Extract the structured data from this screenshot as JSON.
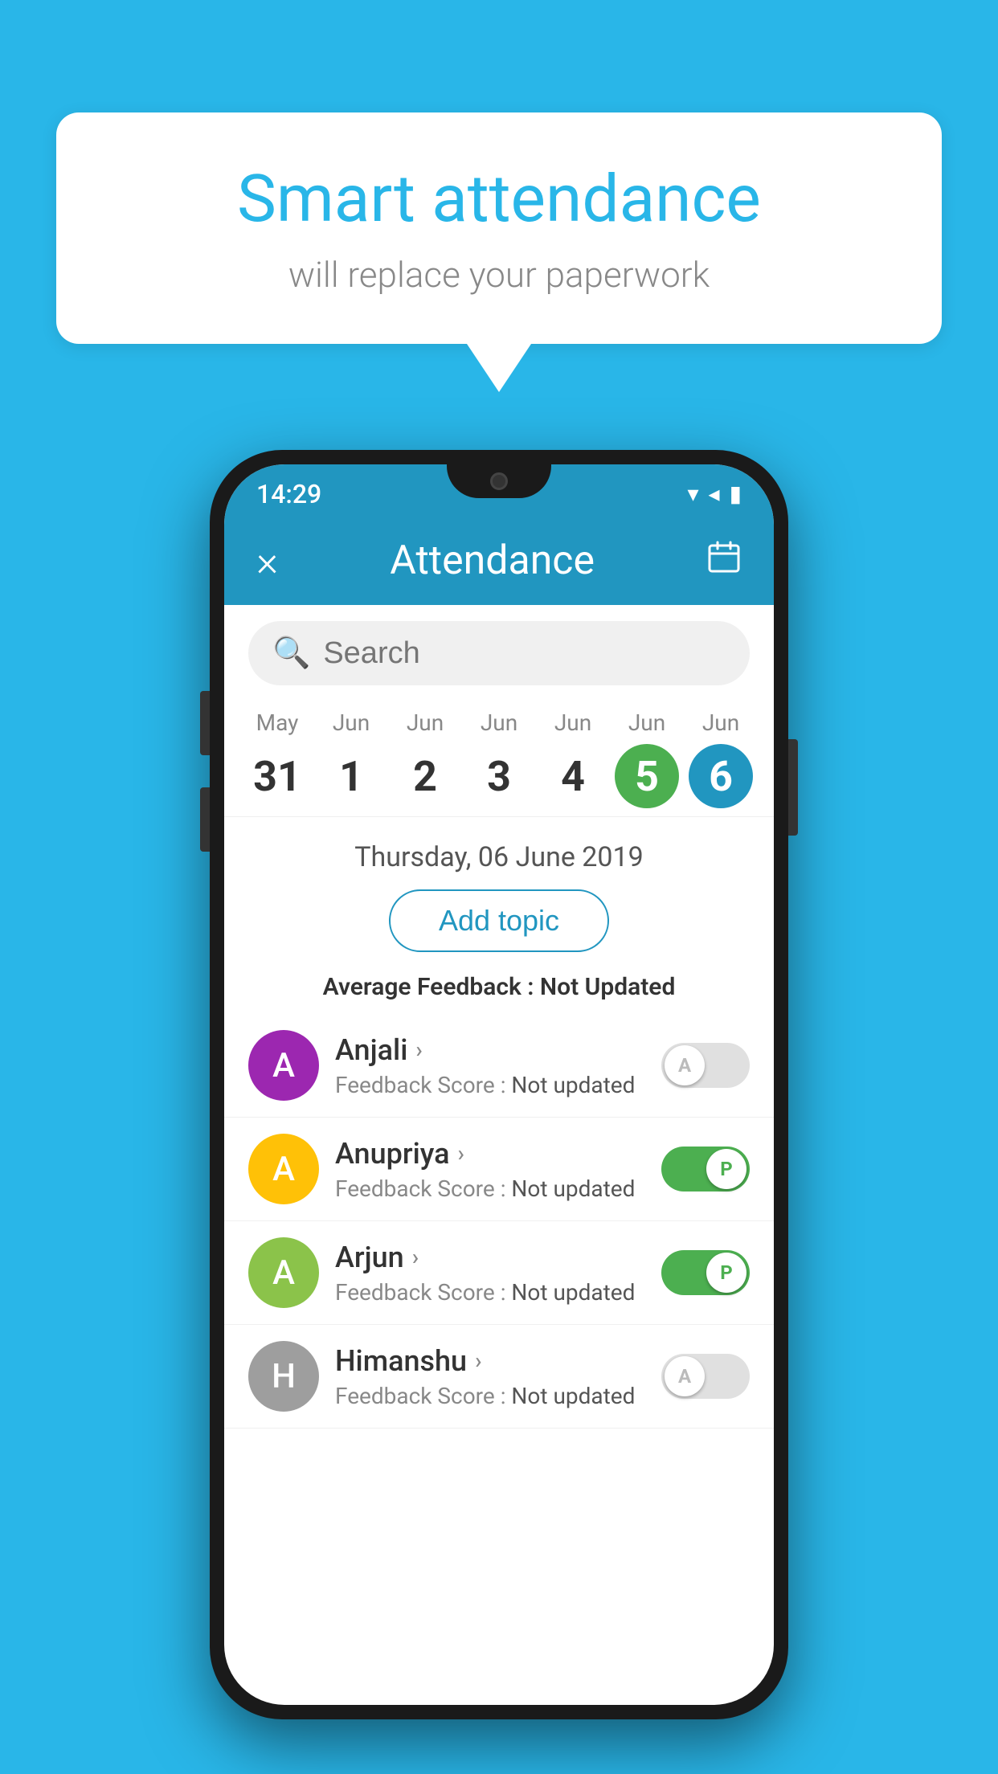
{
  "background_color": "#29b6e8",
  "speech_bubble": {
    "title": "Smart attendance",
    "subtitle": "will replace your paperwork"
  },
  "phone": {
    "status_bar": {
      "time": "14:29",
      "wifi_icon": "▼",
      "signal_icon": "▲",
      "battery_icon": "▮"
    },
    "app_bar": {
      "close_label": "×",
      "title": "Attendance",
      "calendar_icon": "📅"
    },
    "search": {
      "placeholder": "Search"
    },
    "calendar": {
      "days": [
        {
          "month": "May",
          "number": "31",
          "state": "normal"
        },
        {
          "month": "Jun",
          "number": "1",
          "state": "normal"
        },
        {
          "month": "Jun",
          "number": "2",
          "state": "normal"
        },
        {
          "month": "Jun",
          "number": "3",
          "state": "normal"
        },
        {
          "month": "Jun",
          "number": "4",
          "state": "normal"
        },
        {
          "month": "Jun",
          "number": "5",
          "state": "today"
        },
        {
          "month": "Jun",
          "number": "6",
          "state": "selected"
        }
      ]
    },
    "selected_date": "Thursday, 06 June 2019",
    "add_topic_label": "Add topic",
    "average_feedback_label": "Average Feedback :",
    "average_feedback_value": "Not Updated",
    "students": [
      {
        "name": "Anjali",
        "avatar_letter": "A",
        "avatar_color": "#9c27b0",
        "feedback_label": "Feedback Score :",
        "feedback_value": "Not updated",
        "toggle_state": "off",
        "toggle_label": "A"
      },
      {
        "name": "Anupriya",
        "avatar_letter": "A",
        "avatar_color": "#ffc107",
        "feedback_label": "Feedback Score :",
        "feedback_value": "Not updated",
        "toggle_state": "on",
        "toggle_label": "P"
      },
      {
        "name": "Arjun",
        "avatar_letter": "A",
        "avatar_color": "#8bc34a",
        "feedback_label": "Feedback Score :",
        "feedback_value": "Not updated",
        "toggle_state": "on",
        "toggle_label": "P"
      },
      {
        "name": "Himanshu",
        "avatar_letter": "H",
        "avatar_color": "#9e9e9e",
        "feedback_label": "Feedback Score :",
        "feedback_value": "Not updated",
        "toggle_state": "off",
        "toggle_label": "A"
      }
    ]
  }
}
